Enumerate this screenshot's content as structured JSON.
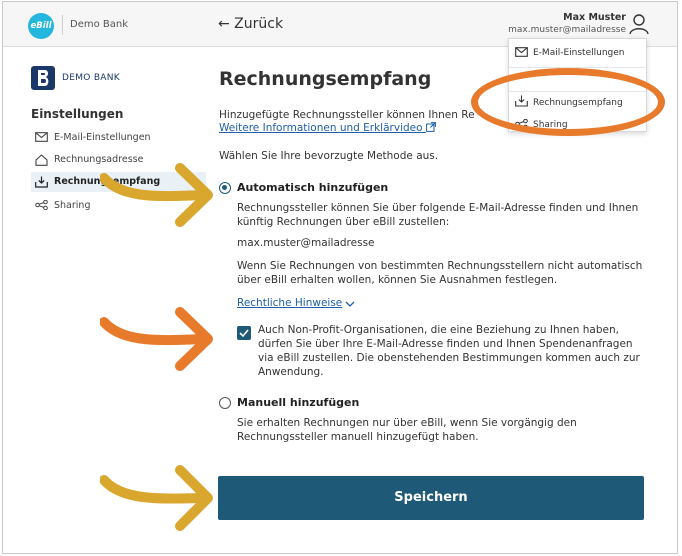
{
  "header": {
    "logo_text": "eBill",
    "bank_name": "Demo Bank",
    "back_label": "← Zurück",
    "user_name": "Max Muster",
    "user_email": "max.muster@mailadresse"
  },
  "dropdown": {
    "items": [
      {
        "label": "E-Mail-Einstellungen",
        "icon": "mail-icon"
      },
      {
        "label": "Rechnungsempfang",
        "icon": "inbox-tray-icon"
      },
      {
        "label": "Sharing",
        "icon": "share-icon"
      }
    ]
  },
  "sidebar": {
    "bank_logo_text": "DEMO BANK",
    "title": "Einstellungen",
    "items": [
      {
        "label": "E-Mail-Einstellungen",
        "icon": "mail-icon",
        "active": false
      },
      {
        "label": "Rechnungsadresse",
        "icon": "home-icon",
        "active": false
      },
      {
        "label": "Rechnungsempfang",
        "icon": "inbox-tray-icon",
        "active": true
      },
      {
        "label": "Sharing",
        "icon": "share-icon",
        "active": false
      }
    ]
  },
  "main": {
    "title": "Rechnungsempfang",
    "intro": "Hinzugefügte Rechnungssteller können Ihnen Re",
    "info_link": "Weitere Informationen und Erklärvideo",
    "choose_text": "Wählen Sie Ihre bevorzugte Methode aus.",
    "option_auto": {
      "title": "Automatisch hinzufügen",
      "selected": true,
      "desc": "Rechnungssteller können Sie über folgende E-Mail-Adresse finden und Ihnen künftig Rechnungen über eBill zustellen:",
      "email": "max.muster@mailadresse",
      "desc2": "Wenn Sie Rechnungen von bestimmten Rechnungsstellern nicht automatisch über eBill erhalten wollen, können Sie Ausnahmen festlegen.",
      "legal_link": "Rechtliche Hinweise",
      "nonprofit_checked": true,
      "nonprofit_text": "Auch Non-Profit-Organisationen, die eine Beziehung zu Ihnen haben, dürfen Sie über Ihre E-Mail-Adresse finden und Ihnen Spendenanfragen via eBill zustellen. Die obenstehenden Bestimmungen kommen auch zur Anwendung."
    },
    "option_manual": {
      "title": "Manuell hinzufügen",
      "selected": false,
      "desc": "Sie erhalten Rechnungen nur über eBill, wenn Sie vorgängig den Rechnungssteller manuell hinzugefügt haben."
    },
    "save_label": "Speichern"
  },
  "colors": {
    "accent": "#1e5a78",
    "link": "#1f5fa8",
    "ebill_blue": "#25b6de",
    "annotation_gold": "#d9a62e",
    "annotation_orange": "#e87a2c"
  }
}
